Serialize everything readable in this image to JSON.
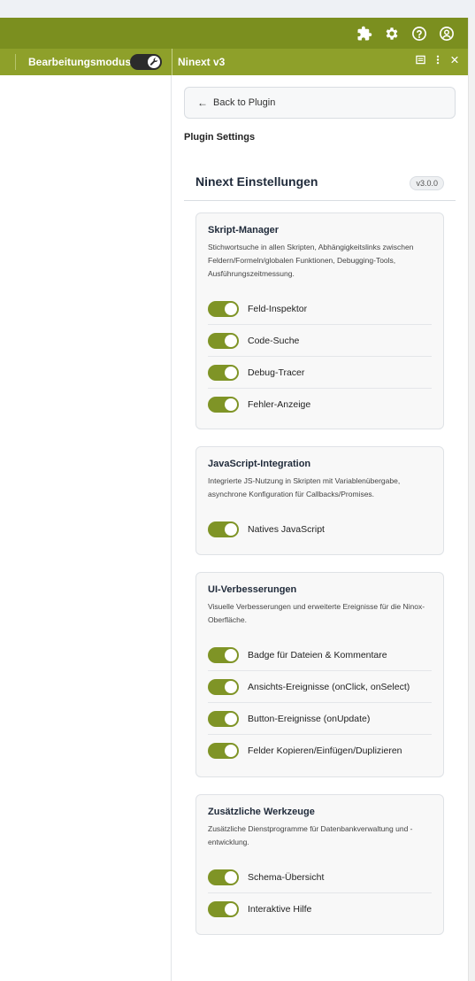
{
  "topbar": {
    "icons": [
      "puzzle-icon",
      "gear-icon",
      "help-icon",
      "user-icon"
    ]
  },
  "subbar": {
    "mode_label": "Bearbeitungsmodus",
    "mode_on": true,
    "panel_title": "Ninext v3",
    "panel_icons": [
      "window-icon",
      "more-icon",
      "close-icon"
    ]
  },
  "panel": {
    "back_label": "Back to Plugin",
    "settings_heading": "Plugin Settings",
    "title": "Ninext Einstellungen",
    "version": "v3.0.0"
  },
  "sections": [
    {
      "title": "Skript-Manager",
      "description": "Stichwortsuche in allen Skripten, Abhängigkeitslinks zwischen Feldern/Formeln/globalen Funktionen, Debugging-Tools, Ausführungszeitmessung.",
      "items": [
        {
          "label": "Feld-Inspektor",
          "on": true
        },
        {
          "label": "Code-Suche",
          "on": true
        },
        {
          "label": "Debug-Tracer",
          "on": true
        },
        {
          "label": "Fehler-Anzeige",
          "on": true
        }
      ]
    },
    {
      "title": "JavaScript-Integration",
      "description": "Integrierte JS-Nutzung in Skripten mit Variablenübergabe, asynchrone Konfiguration für Callbacks/Promises.",
      "items": [
        {
          "label": "Natives JavaScript",
          "on": true
        }
      ]
    },
    {
      "title": "UI-Verbesserungen",
      "description": "Visuelle Verbesserungen und erweiterte Ereignisse für die Ninox-Oberfläche.",
      "items": [
        {
          "label": "Badge für Dateien & Kommentare",
          "on": true
        },
        {
          "label": "Ansichts-Ereignisse (onClick, onSelect)",
          "on": true
        },
        {
          "label": "Button-Ereignisse (onUpdate)",
          "on": true
        },
        {
          "label": "Felder Kopieren/Einfügen/Duplizieren",
          "on": true
        }
      ]
    },
    {
      "title": "Zusätzliche Werkzeuge",
      "description": "Zusätzliche Dienstprogramme für Datenbankverwaltung und -entwicklung.",
      "items": [
        {
          "label": "Schema-Übersicht",
          "on": true
        },
        {
          "label": "Interaktive Hilfe",
          "on": true
        }
      ]
    }
  ],
  "colors": {
    "topbar": "#7b8f1f",
    "subbar": "#8ea02a",
    "toggle_on": "#7f9426"
  }
}
